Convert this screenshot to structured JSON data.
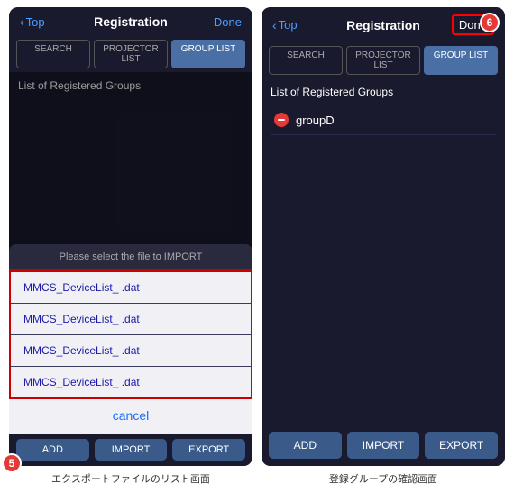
{
  "screens": [
    {
      "id": "screen-left",
      "header": {
        "back_label": "Top",
        "title": "Registration",
        "done_label": "Done",
        "done_highlighted": false
      },
      "tabs": [
        {
          "id": "search",
          "label": "SEARCH",
          "active": false
        },
        {
          "id": "projector-list",
          "label": "PROJECTOR LIST",
          "active": false
        },
        {
          "id": "group-list",
          "label": "GROUP LIST",
          "active": true
        }
      ],
      "section_title": "List of Registered Groups",
      "groups": [],
      "import_dialog": {
        "title": "Please select the file to IMPORT",
        "files": [
          "MMCS_DeviceList_                    .dat",
          "MMCS_DeviceList_                    .dat",
          "MMCS_DeviceList_                    .dat",
          "MMCS_DeviceList_                    .dat"
        ],
        "cancel_label": "cancel"
      },
      "toolbar": {
        "buttons": [
          "ADD",
          "IMPORT",
          "EXPORT"
        ]
      },
      "badge": "5",
      "caption": "エクスポートファイルのリスト画面"
    },
    {
      "id": "screen-right",
      "header": {
        "back_label": "Top",
        "title": "Registration",
        "done_label": "Done",
        "done_highlighted": true
      },
      "tabs": [
        {
          "id": "search",
          "label": "SEARCH",
          "active": false
        },
        {
          "id": "projector-list",
          "label": "PROJECTOR LIST",
          "active": false
        },
        {
          "id": "group-list",
          "label": "GROUP LIST",
          "active": true
        }
      ],
      "section_title": "List of Registered Groups",
      "groups": [
        {
          "label": "groupD"
        }
      ],
      "bottom_buttons": [
        "ADD",
        "IMPORT",
        "EXPORT"
      ],
      "badge": "6",
      "caption": "登録グループの確認画面"
    }
  ]
}
